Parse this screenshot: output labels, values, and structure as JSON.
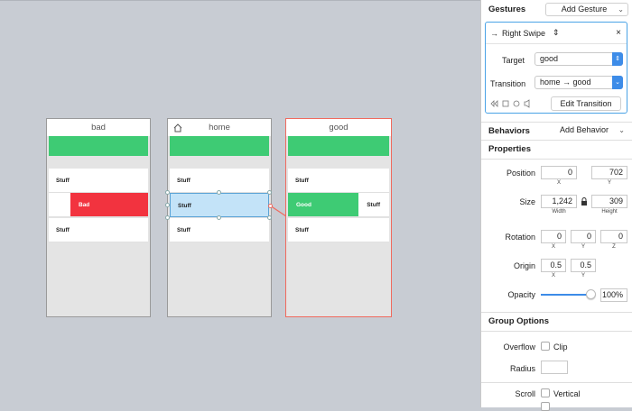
{
  "canvas": {
    "artboards": [
      {
        "title": "bad",
        "rows": [
          "Stuff",
          "",
          "Stuff"
        ],
        "red_label": "Bad"
      },
      {
        "title": "home",
        "rows": [
          "Stuff",
          "Stuff",
          "Stuff"
        ]
      },
      {
        "title": "good",
        "rows": [
          "Stuff",
          "Stuff",
          "Stuff"
        ],
        "green_label": "Good"
      }
    ]
  },
  "panel": {
    "gestures": {
      "title": "Gestures",
      "add_label": "Add Gesture",
      "gesture_name": "Right Swipe",
      "target_label": "Target",
      "target_value": "good",
      "transition_label": "Transition",
      "transition_value": "home → good",
      "edit_label": "Edit Transition"
    },
    "behaviors": {
      "title": "Behaviors",
      "add_label": "Add Behavior"
    },
    "properties": {
      "title": "Properties",
      "position_label": "Position",
      "position_x": "0",
      "position_y": "702",
      "x_sub": "X",
      "y_sub": "Y",
      "z_sub": "Z",
      "size_label": "Size",
      "width": "1,242",
      "height": "309",
      "width_sub": "Width",
      "height_sub": "Height",
      "rotation_label": "Rotation",
      "rot_x": "0",
      "rot_y": "0",
      "rot_z": "0",
      "origin_label": "Origin",
      "origin_x": "0.5",
      "origin_y": "0.5",
      "opacity_label": "Opacity",
      "opacity_value": "100%",
      "opacity_fraction": 1.0
    },
    "group": {
      "title": "Group Options",
      "overflow_label": "Overflow",
      "clip_label": "Clip",
      "radius_label": "Radius",
      "radius_value": "",
      "scroll_label": "Scroll",
      "vertical_label": "Vertical"
    }
  },
  "colors": {
    "canvas_bg": "#c8ccd3",
    "green": "#3ecb74",
    "red": "#f2333f",
    "accent_blue": "#3d8ce8",
    "selection": "#f06a5e"
  }
}
